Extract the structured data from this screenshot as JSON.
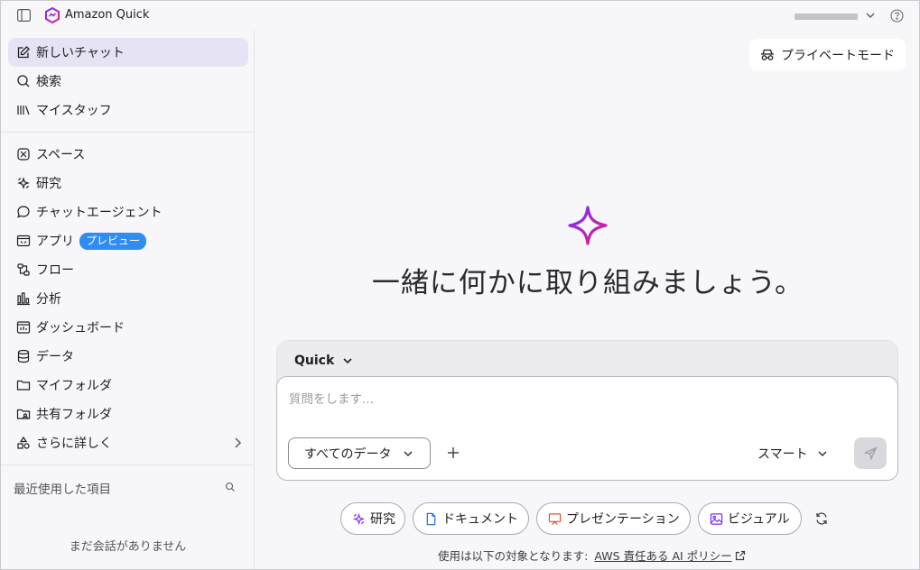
{
  "app": {
    "title": "Amazon Quick"
  },
  "sidebar": {
    "new_chat": "新しいチャット",
    "search": "検索",
    "my_stuff": "マイスタッフ",
    "spaces": "スペース",
    "research": "研究",
    "chat_agents": "チャットエージェント",
    "apps": "アプリ",
    "apps_badge": "プレビュー",
    "flows": "フロー",
    "analysis": "分析",
    "dashboards": "ダッシュボード",
    "data": "データ",
    "my_folders": "マイフォルダ",
    "shared_folders": "共有フォルダ",
    "more": "さらに詳しく",
    "recent_label": "最近使用した項目",
    "empty_text": "まだ会話がありません"
  },
  "main": {
    "private_mode": "プライベートモード",
    "headline": "一緒に何かに取り組みましょう。",
    "model": "Quick",
    "input_placeholder": "質問をします...",
    "data_scope": "すべてのデータ",
    "mode": "スマート",
    "chips": {
      "research": "研究",
      "document": "ドキュメント",
      "presentation": "プレゼンテーション",
      "visual": "ビジュアル"
    },
    "footer_prefix": "使用は以下の対象となります:",
    "footer_link": "AWS 責任ある AI ポリシー"
  },
  "colors": {
    "accent": "#e6e3f5",
    "badge": "#2f8cf0",
    "brand_gradient_start": "#7b2ff7",
    "brand_gradient_end": "#e0208a"
  },
  "icons": [
    "sidebar-toggle-icon",
    "quick-logo-icon",
    "chevron-down-icon",
    "help-icon",
    "edit-icon",
    "search-icon",
    "library-icon",
    "spaces-icon",
    "research-icon",
    "chat-icon",
    "apps-icon",
    "flow-icon",
    "chart-icon",
    "dashboard-icon",
    "database-icon",
    "folder-icon",
    "shared-folder-icon",
    "shapes-icon",
    "chevron-right-icon",
    "incognito-icon",
    "sparkle-icon",
    "plus-icon",
    "send-icon",
    "document-icon",
    "presentation-icon",
    "image-icon",
    "refresh-icon",
    "external-link-icon"
  ]
}
